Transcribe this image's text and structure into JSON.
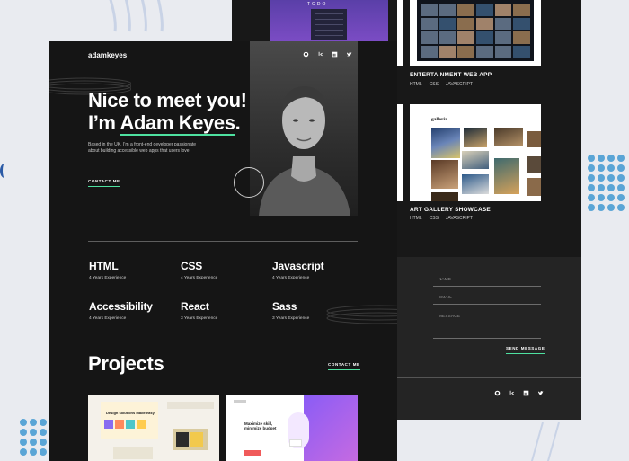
{
  "portfolio": {
    "logo": "adamkeyes",
    "hero": {
      "line1": "Nice to meet you!",
      "line2_prefix": "I’m ",
      "name": "Adam Keyes",
      "line2_suffix": ".",
      "description": "Based in the UK, I’m a front-end developer passionate about building accessible web apps that users love.",
      "contact_label": "CONTACT ME"
    },
    "social_icons": [
      "github-icon",
      "frontend-mentor-icon",
      "linkedin-icon",
      "twitter-icon"
    ],
    "skills": [
      {
        "name": "HTML",
        "experience": "4 Years Experience"
      },
      {
        "name": "CSS",
        "experience": "4 Years Experience"
      },
      {
        "name": "Javascript",
        "experience": "4 Years Experience"
      },
      {
        "name": "Accessibility",
        "experience": "4 Years Experience"
      },
      {
        "name": "React",
        "experience": "3 Years Experience"
      },
      {
        "name": "Sass",
        "experience": "3 Years Experience"
      }
    ],
    "projects_heading": "Projects",
    "projects_contact_label": "CONTACT ME",
    "cards": [
      {
        "headline": "Design solutions made easy"
      },
      {
        "headline": "Maximize skill, minimize budget"
      }
    ]
  },
  "right_panel": {
    "todo_label": "TODO",
    "projects": [
      {
        "title": "ENTERTAINMENT WEB APP",
        "tags": [
          "HTML",
          "CSS",
          "JAVASCRIPT"
        ]
      },
      {
        "title": "ART GALLERY SHOWCASE",
        "tags": [
          "HTML",
          "CSS",
          "JAVASCRIPT"
        ]
      }
    ],
    "gallery_logo": "galleria.",
    "contact_form": {
      "name_placeholder": "NAME",
      "email_placeholder": "EMAIL",
      "message_placeholder": "MESSAGE",
      "send_label": "SEND MESSAGE"
    }
  },
  "colors": {
    "accent": "#4ee1a0",
    "background": "#151515",
    "page_bg": "#e9ebf0",
    "dots": "#5aa5d6"
  }
}
